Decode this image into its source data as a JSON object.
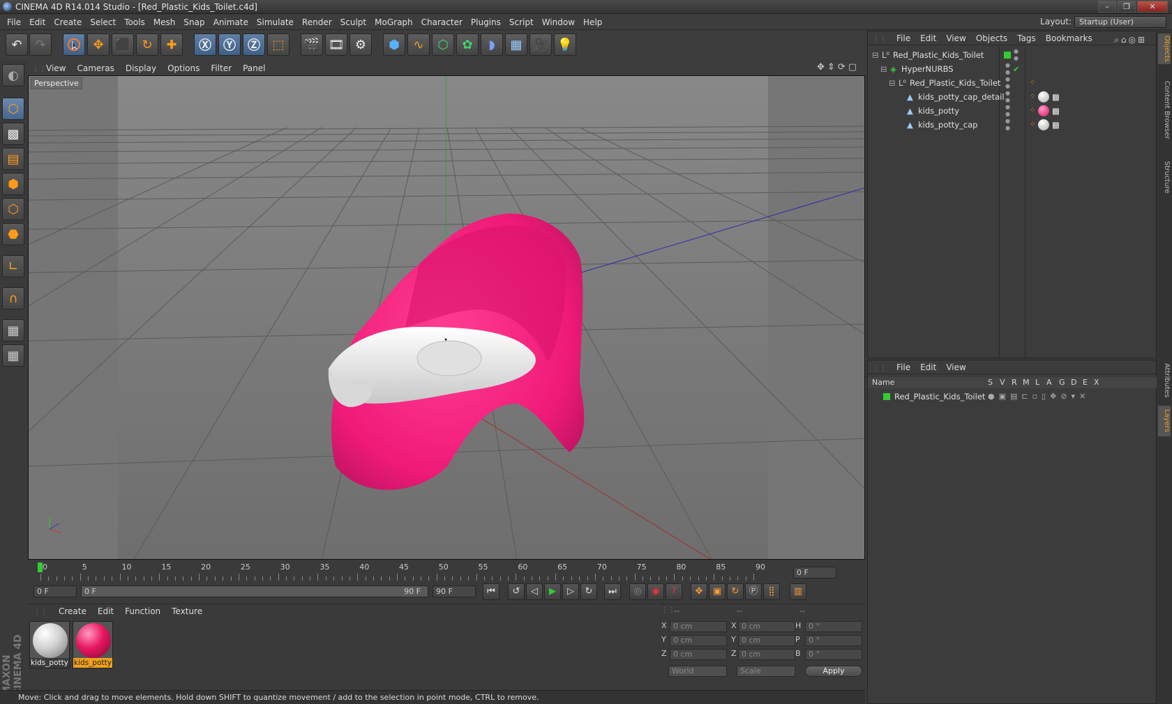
{
  "window": {
    "title": "CINEMA 4D R14.014 Studio - [Red_Plastic_Kids_Toilet.c4d]",
    "buttons": [
      "–",
      "❐",
      "✕"
    ]
  },
  "menubar": {
    "items": [
      "File",
      "Edit",
      "Create",
      "Select",
      "Tools",
      "Mesh",
      "Snap",
      "Animate",
      "Simulate",
      "Render",
      "Sculpt",
      "MoGraph",
      "Character",
      "Plugins",
      "Script",
      "Window",
      "Help"
    ],
    "layout_label": "Layout:",
    "layout_value": "Startup (User)"
  },
  "viewport": {
    "menu": [
      "View",
      "Cameras",
      "Display",
      "Options",
      "Filter",
      "Panel"
    ],
    "label": "Perspective",
    "colors": {
      "potty": "#ff1c7c",
      "seat": "#e8e8e8",
      "bg": "#7a7a7a"
    }
  },
  "timeline": {
    "ticks": [
      "0",
      "5",
      "10",
      "15",
      "20",
      "25",
      "30",
      "35",
      "40",
      "45",
      "50",
      "55",
      "60",
      "65",
      "70",
      "75",
      "80",
      "85",
      "90"
    ],
    "current_frame": "0 F"
  },
  "transport": {
    "start": "0 F",
    "range_start": "0 F",
    "range_end": "90 F",
    "end": "90 F"
  },
  "materials": {
    "menu": [
      "Create",
      "Edit",
      "Function",
      "Texture"
    ],
    "items": [
      {
        "label": "kids_potty",
        "color": "#e0e0e0",
        "selected": false
      },
      {
        "label": "kids_potty",
        "color": "#e8175f",
        "selected": true
      }
    ]
  },
  "coordinates": {
    "headers": [
      "--",
      "--",
      "--"
    ],
    "rows": [
      {
        "a": "X",
        "av": "0 cm",
        "b": "X",
        "bv": "0 cm",
        "c": "H",
        "cv": "0 °"
      },
      {
        "a": "Y",
        "av": "0 cm",
        "b": "Y",
        "bv": "0 cm",
        "c": "P",
        "cv": "0 °"
      },
      {
        "a": "Z",
        "av": "0 cm",
        "b": "Z",
        "bv": "0 cm",
        "c": "B",
        "cv": "0 °"
      }
    ],
    "mode1": "World",
    "mode2": "Scale",
    "apply": "Apply"
  },
  "status": "Move: Click and drag to move elements. Hold down SHIFT to quantize movement / add to the selection in point mode, CTRL to remove.",
  "objects": {
    "menu": [
      "File",
      "Edit",
      "View",
      "Objects",
      "Tags",
      "Bookmarks"
    ],
    "tree": [
      {
        "name": "Red_Plastic_Kids_Toilet",
        "indent": 0,
        "icon": "null-icon"
      },
      {
        "name": "HyperNURBS",
        "indent": 1,
        "icon": "hypernurbs-icon"
      },
      {
        "name": "Red_Plastic_Kids_Toilet",
        "indent": 2,
        "icon": "null-icon"
      },
      {
        "name": "kids_potty_cap_detail",
        "indent": 3,
        "icon": "polygon-icon"
      },
      {
        "name": "kids_potty",
        "indent": 3,
        "icon": "polygon-icon"
      },
      {
        "name": "kids_potty_cap",
        "indent": 3,
        "icon": "polygon-icon"
      }
    ]
  },
  "layers": {
    "menu": [
      "File",
      "Edit",
      "View"
    ],
    "columns": [
      "Name",
      "S",
      "V",
      "R",
      "M",
      "L",
      "A",
      "G",
      "D",
      "E",
      "X"
    ],
    "rows": [
      {
        "name": "Red_Plastic_Kids_Toilet",
        "color": "#33cc33"
      }
    ]
  },
  "side_tabs": [
    "Objects",
    "Content Browser",
    "Structure",
    "Attributes",
    "Layers"
  ],
  "brand": "MAXON CINEMA 4D"
}
